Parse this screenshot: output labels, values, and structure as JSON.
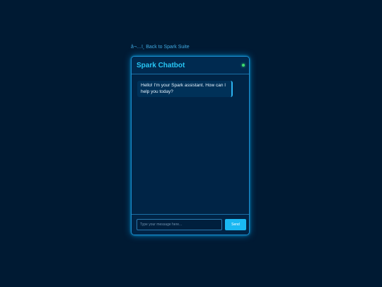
{
  "nav": {
    "back_link": "â¬…ï¸ Back to Spark Suite"
  },
  "chat": {
    "title": "Spark Chatbot",
    "status": "online",
    "status_color": "#3ddc6e",
    "messages": [
      {
        "sender": "bot",
        "text": "Hello! I'm your Spark assistant. How can I help you today?"
      }
    ],
    "input": {
      "value": "",
      "placeholder": "Type your message here..."
    },
    "send_label": "Send"
  },
  "colors": {
    "background": "#001a33",
    "accent": "#27c6f5",
    "panel": "#002446",
    "button": "#1ab8f2"
  }
}
